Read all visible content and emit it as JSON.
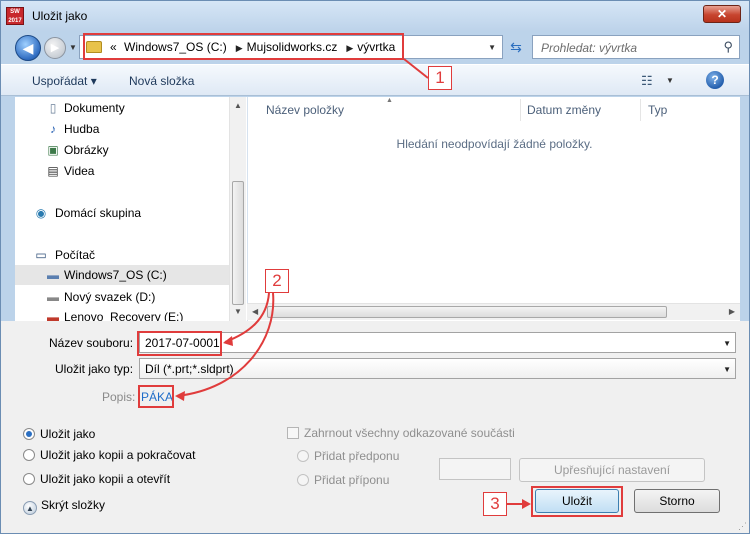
{
  "window": {
    "title": "Uložit jako",
    "app_icon_text": "2017",
    "close_glyph": "✕"
  },
  "address": {
    "overflow": "«",
    "crumbs": [
      "Windows7_OS (C:)",
      "Mujsolidworks.cz",
      "vývrtka"
    ],
    "search_placeholder": "Prohledat: vývrtka"
  },
  "toolbar": {
    "organize": "Uspořádat ▾",
    "new_folder": "Nová složka"
  },
  "navpane": {
    "items": [
      {
        "label": "Dokumenty",
        "icon": "📄"
      },
      {
        "label": "Hudba",
        "icon": "♪"
      },
      {
        "label": "Obrázky",
        "icon": "▣"
      },
      {
        "label": "Videa",
        "icon": "▤"
      },
      {
        "label": "Domácí skupina",
        "icon": "◉"
      },
      {
        "label": "Počítač",
        "icon": "▭"
      },
      {
        "label": "Windows7_OS (C:)",
        "icon": "▬"
      },
      {
        "label": "Nový svazek (D:)",
        "icon": "▬"
      },
      {
        "label": "Lenovo_Recovery (E:)",
        "icon": "▬"
      }
    ]
  },
  "filelist": {
    "columns": [
      "Název položky",
      "Datum změny",
      "Typ"
    ],
    "empty_message": "Hledání neodpovídají žádné položky."
  },
  "form": {
    "filename_label": "Název souboru:",
    "filename_value": "2017-07-0001",
    "type_label": "Uložit jako typ:",
    "type_value": "Díl (*.prt;*.sldprt)",
    "desc_label": "Popis:",
    "desc_value": "PÁKA"
  },
  "options": {
    "radios": [
      "Uložit jako",
      "Uložit jako kopii a pokračovat",
      "Uložit jako kopii a otevřít"
    ],
    "selected": 0,
    "include_refs": "Zahrnout všechny odkazované součásti",
    "prefix": "Přidat předponu",
    "suffix": "Přidat příponu",
    "advanced": "Upřesňující nastavení",
    "hide_folders": "Skrýt složky"
  },
  "buttons": {
    "save": "Uložit",
    "cancel": "Storno"
  },
  "annotations": [
    "1",
    "2",
    "3"
  ],
  "colors": {
    "annotation": "#e03c3c",
    "link": "#1e6cc8"
  }
}
